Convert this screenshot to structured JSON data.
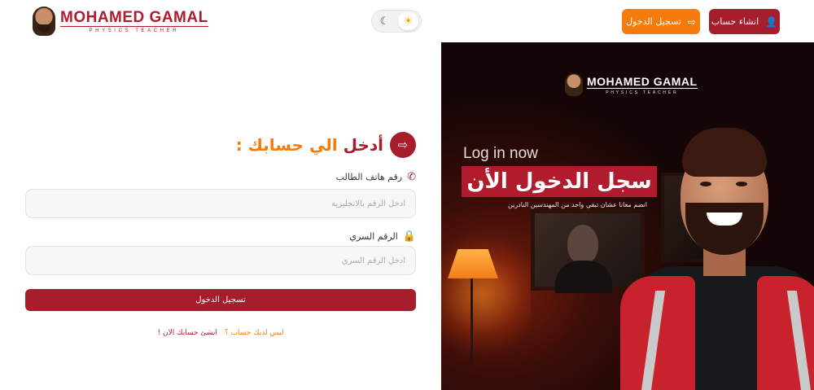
{
  "brand": {
    "name": "MOHAMED GAMAL",
    "subtitle": "PHYSICS TEACHER"
  },
  "header": {
    "login_button": "تسجيل الدخول",
    "signup_button": "انشاء حساب",
    "theme_options": [
      "moon-icon",
      "sun-icon"
    ],
    "theme_active": "light"
  },
  "login_form": {
    "title_part1": "أدخل",
    "title_part2": "الي حسابك :",
    "phone_label": "رقم هاتف الطالب",
    "phone_placeholder": "ادخل الرقم بالانجليزية",
    "password_label": "الرقم السري",
    "password_placeholder": "ادخل الرقم السري",
    "submit_button": "تسجيل الدخول",
    "no_account_text": "ليس لديك حساب ؟",
    "create_account_link": "انشئ حسابك الان !"
  },
  "hero": {
    "brand_name": "MOHAMED GAMAL",
    "brand_subtitle": "PHYSICS TEACHER",
    "login_now": "Log in now",
    "title": "سجل الدخول الأن",
    "subtitle": "انضم معانا عشان تبقي واحد من المهندسين النادرين"
  },
  "colors": {
    "primary": "#a61d2c",
    "accent": "#f57c0a",
    "input_bg": "#f7f7f7"
  }
}
